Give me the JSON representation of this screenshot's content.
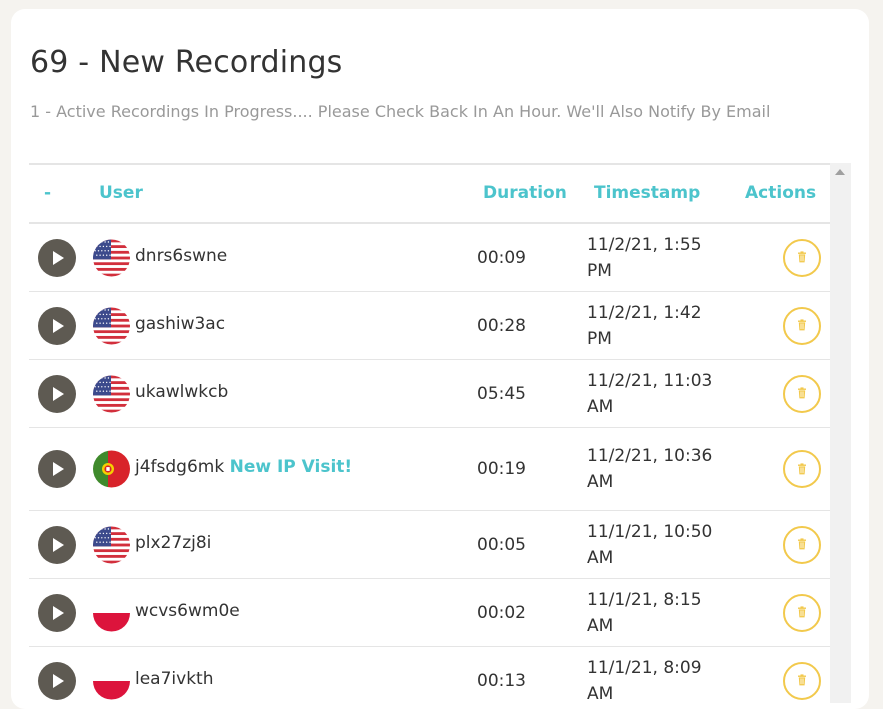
{
  "header": {
    "title": "69 - New Recordings",
    "subtitle": "1 - Active Recordings In Progress.... Please Check Back In An Hour. We'll Also Notify By Email"
  },
  "table": {
    "columns": [
      "-",
      "User",
      "Duration",
      "Timestamp",
      "Actions"
    ],
    "rows": [
      {
        "flag": "us-flag",
        "user": "dnrs6swne",
        "badge": "",
        "duration": "00:09",
        "timestamp": "11/2/21, 1:55 PM"
      },
      {
        "flag": "us-flag",
        "user": "gashiw3ac",
        "badge": "",
        "duration": "00:28",
        "timestamp": "11/2/21, 1:42 PM"
      },
      {
        "flag": "us-flag",
        "user": "ukawlwkcb",
        "badge": "",
        "duration": "05:45",
        "timestamp": "11/2/21, 11:03 AM"
      },
      {
        "flag": "portugal-flag",
        "user": "j4fsdg6mk",
        "badge": "New IP Visit!",
        "duration": "00:19",
        "timestamp": "11/2/21, 10:36 AM"
      },
      {
        "flag": "us-flag",
        "user": "plx27zj8i",
        "badge": "",
        "duration": "00:05",
        "timestamp": "11/1/21, 10:50 AM"
      },
      {
        "flag": "poland-flag",
        "user": "wcvs6wm0e",
        "badge": "",
        "duration": "00:02",
        "timestamp": "11/1/21, 8:15 AM"
      },
      {
        "flag": "poland-flag",
        "user": "lea7ivkth",
        "badge": "",
        "duration": "00:13",
        "timestamp": "11/1/21, 8:09 AM"
      }
    ]
  },
  "colors": {
    "accent": "#4cc4cc",
    "play_button": "#5e5a52",
    "delete_outline": "#f2c94c",
    "background": "#f5f3ef"
  }
}
